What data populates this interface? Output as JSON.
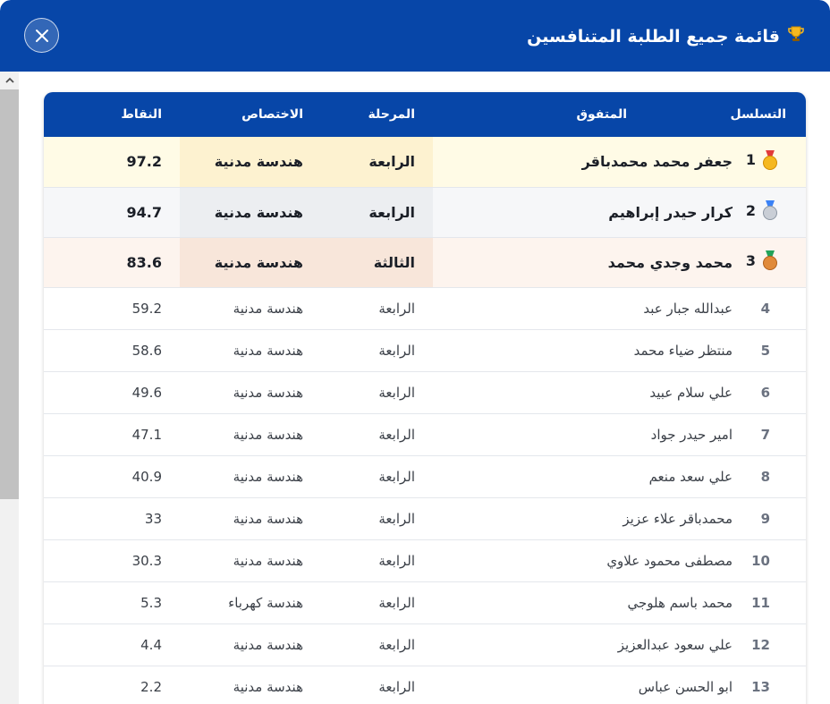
{
  "dialog": {
    "title": "قائمة جميع الطلبة المتنافسين",
    "trophy_icon": "trophy-icon",
    "close_icon": "close-icon",
    "header_color": "#0746a8"
  },
  "table": {
    "headers": {
      "rank": "التسلسل",
      "name": "المتفوق",
      "stage": "المرحلة",
      "specialization": "الاختصاص",
      "points": "النقاط"
    },
    "rows": [
      {
        "rank": "1",
        "name": "جعفر محمد محمدباقر",
        "stage": "الرابعة",
        "specialization": "هندسة مدنية",
        "points": "97.2",
        "medal": "gold"
      },
      {
        "rank": "2",
        "name": "كرار حيدر إبراهيم",
        "stage": "الرابعة",
        "specialization": "هندسة مدنية",
        "points": "94.7",
        "medal": "silver"
      },
      {
        "rank": "3",
        "name": "محمد وجدي محمد",
        "stage": "الثالثة",
        "specialization": "هندسة مدنية",
        "points": "83.6",
        "medal": "bronze"
      },
      {
        "rank": "4",
        "name": "عبدالله جبار عبد",
        "stage": "الرابعة",
        "specialization": "هندسة مدنية",
        "points": "59.2"
      },
      {
        "rank": "5",
        "name": "منتظر ضياء محمد",
        "stage": "الرابعة",
        "specialization": "هندسة مدنية",
        "points": "58.6"
      },
      {
        "rank": "6",
        "name": "علي سلام عبيد",
        "stage": "الرابعة",
        "specialization": "هندسة مدنية",
        "points": "49.6"
      },
      {
        "rank": "7",
        "name": "امير حيدر جواد",
        "stage": "الرابعة",
        "specialization": "هندسة مدنية",
        "points": "47.1"
      },
      {
        "rank": "8",
        "name": "علي سعد منعم",
        "stage": "الرابعة",
        "specialization": "هندسة مدنية",
        "points": "40.9"
      },
      {
        "rank": "9",
        "name": "محمدباقر علاء عزيز",
        "stage": "الرابعة",
        "specialization": "هندسة مدنية",
        "points": "33"
      },
      {
        "rank": "10",
        "name": "مصطفى محمود علاوي",
        "stage": "الرابعة",
        "specialization": "هندسة مدنية",
        "points": "30.3"
      },
      {
        "rank": "11",
        "name": "محمد باسم هلوجي",
        "stage": "الرابعة",
        "specialization": "هندسة كهرباء",
        "points": "5.3"
      },
      {
        "rank": "12",
        "name": "علي سعود عبدالعزيز",
        "stage": "الرابعة",
        "specialization": "هندسة مدنية",
        "points": "4.4"
      },
      {
        "rank": "13",
        "name": "ابو الحسن عباس",
        "stage": "الرابعة",
        "specialization": "هندسة مدنية",
        "points": "2.2"
      }
    ]
  }
}
